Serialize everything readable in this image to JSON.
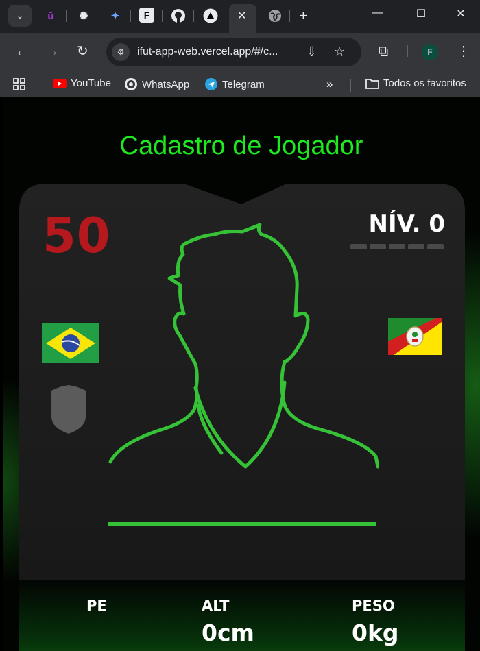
{
  "browser": {
    "tabs": [
      {
        "icon": "tab-search-icon"
      },
      {
        "icon": "u-app-icon",
        "glyph": "ŭ"
      },
      {
        "icon": "chatgpt-icon",
        "glyph": "✺"
      },
      {
        "icon": "gemini-icon",
        "glyph": "✦"
      },
      {
        "icon": "f-app-icon",
        "glyph": "F"
      },
      {
        "icon": "github-icon",
        "glyph": "●"
      },
      {
        "icon": "vercel-icon",
        "glyph": "▲"
      },
      {
        "icon": "globe-icon",
        "glyph": "🌐"
      }
    ],
    "address_bar": {
      "url": "ifut-app-web.vercel.app/#/c..."
    },
    "profile_initial": "F",
    "bookmarks": [
      {
        "label": "YouTube",
        "icon": "youtube-icon"
      },
      {
        "label": "WhatsApp",
        "icon": "whatsapp-icon"
      },
      {
        "label": "Telegram",
        "icon": "telegram-icon"
      }
    ],
    "all_bookmarks_label": "Todos os favoritos"
  },
  "page": {
    "title": "Cadastro de Jogador",
    "card": {
      "overall": "50",
      "level_label": "NÍV. 0",
      "level_progress": 0,
      "nationality_flag": "brazil-flag",
      "state_flag": "rio-grande-do-sul-flag",
      "club_crest": "placeholder-crest-icon",
      "player_name": "",
      "stats": [
        {
          "label": "PE",
          "value": ""
        },
        {
          "label": "ALT",
          "value": "0cm"
        },
        {
          "label": "PESO",
          "value": "0kg"
        }
      ]
    }
  },
  "colors": {
    "title_green": "#1ee81e",
    "outline_green": "#36c236",
    "overall_red": "#b5191e",
    "card_bg": "#1d1d1d"
  }
}
